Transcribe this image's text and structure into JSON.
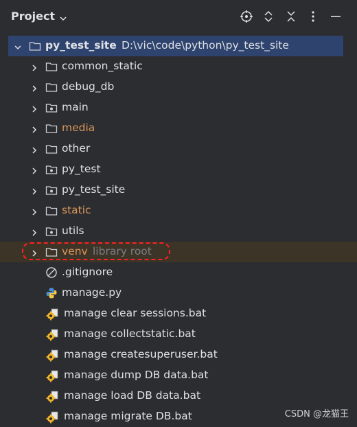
{
  "header": {
    "title": "Project"
  },
  "root": {
    "name": "py_test_site",
    "path": "D:\\vic\\code\\python\\py_test_site"
  },
  "folders": [
    {
      "label": "common_static",
      "style": "normal",
      "icon": "folder-icon"
    },
    {
      "label": "debug_db",
      "style": "normal",
      "icon": "folder-icon"
    },
    {
      "label": "main",
      "style": "normal",
      "icon": "package-icon"
    },
    {
      "label": "media",
      "style": "orange",
      "icon": "folder-icon"
    },
    {
      "label": "other",
      "style": "normal",
      "icon": "folder-icon"
    },
    {
      "label": "py_test",
      "style": "normal",
      "icon": "package-icon"
    },
    {
      "label": "py_test_site",
      "style": "normal",
      "icon": "package-icon"
    },
    {
      "label": "static",
      "style": "orange",
      "icon": "folder-icon"
    },
    {
      "label": "utils",
      "style": "normal",
      "icon": "package-icon"
    }
  ],
  "venv": {
    "label": "venv",
    "hint": "library root"
  },
  "files": [
    {
      "label": ".gitignore",
      "icon": "ignore-icon"
    },
    {
      "label": "manage.py",
      "icon": "python-icon"
    },
    {
      "label": "manage clear sessions.bat",
      "icon": "bat-gear-icon"
    },
    {
      "label": "manage collectstatic.bat",
      "icon": "bat-gear-icon"
    },
    {
      "label": "manage createsuperuser.bat",
      "icon": "bat-gear-icon"
    },
    {
      "label": "manage dump DB data.bat",
      "icon": "bat-gear-icon"
    },
    {
      "label": "manage load DB data.bat",
      "icon": "bat-gear-icon"
    },
    {
      "label": "manage migrate DB.bat",
      "icon": "bat-gear-icon"
    }
  ],
  "watermark": "CSDN @龙猫王",
  "colors": {
    "background": "#2b2d30",
    "selection": "#2e436e",
    "orange_text": "#d9975b",
    "muted_text": "#7a7e85",
    "highlight_row": "#3d3428",
    "annotation": "#ff2020"
  }
}
